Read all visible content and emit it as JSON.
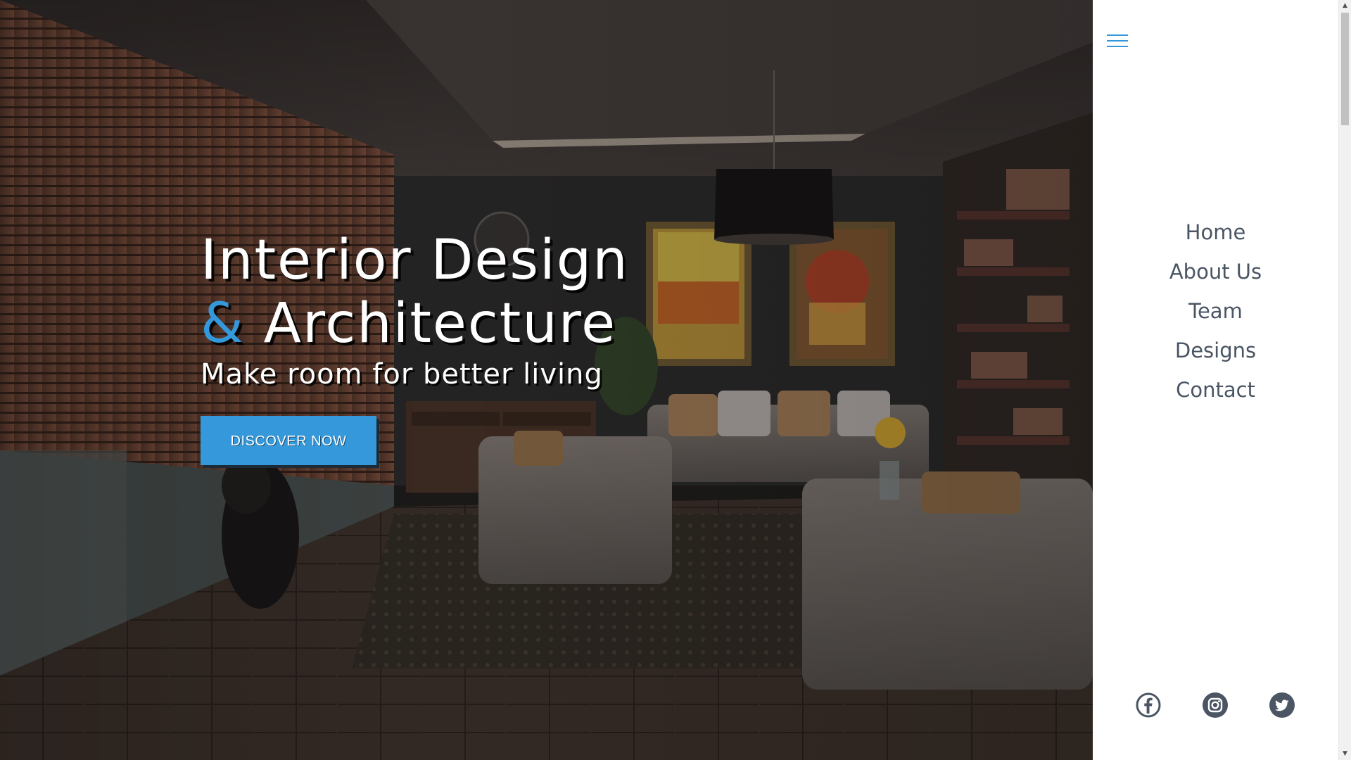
{
  "hero": {
    "title_line1": "Interior Design",
    "title_amp": "&",
    "title_line2": " Architecture",
    "subtitle": "Make room for better living",
    "cta_label": "DISCOVER NOW"
  },
  "menu": {
    "toggle_icon": "hamburger-icon",
    "items": [
      {
        "label": "Home"
      },
      {
        "label": "About Us"
      },
      {
        "label": "Team"
      },
      {
        "label": "Designs"
      },
      {
        "label": "Contact"
      }
    ]
  },
  "social": [
    {
      "icon": "facebook-icon"
    },
    {
      "icon": "instagram-icon"
    },
    {
      "icon": "twitter-icon"
    }
  ],
  "colors": {
    "accent": "#3498db",
    "nav_text": "#4a5563",
    "icon_gray": "#4b5563"
  }
}
